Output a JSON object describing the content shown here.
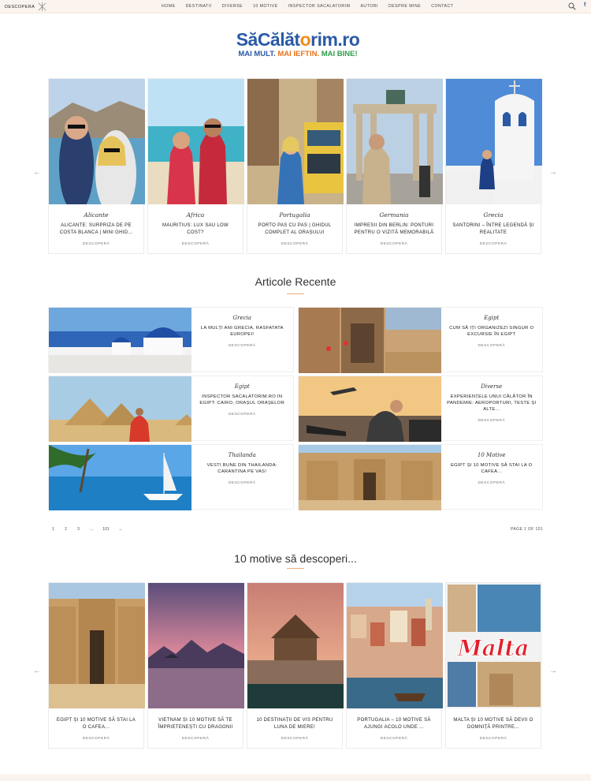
{
  "topbar": {
    "menu_label": "DESCOPERA",
    "nav": [
      "HOME",
      "DESTINATII",
      "DIVERSE",
      "10 MOTIVE",
      "INSPECTOR SACALATORIM",
      "AUTORI",
      "DESPRE MINE",
      "CONTACT"
    ],
    "social": "f"
  },
  "logo": {
    "brand_part1": "SăCălăt",
    "brand_part2": "o",
    "brand_part3": "rim.ro",
    "tag1": "MAI MULT.",
    "tag2": "MAI IEFTIN.",
    "tag3": "MAI BINE!"
  },
  "featured": [
    {
      "category": "Alicante",
      "title": "ALICANTE: SURPRIZA DE PE COSTA BLANCA | MINI GHID...",
      "more": "DESCOPERĂ"
    },
    {
      "category": "Africa",
      "title": "MAURITIUS: LUX SAU LOW COST?",
      "more": "DESCOPERĂ"
    },
    {
      "category": "Portugalia",
      "title": "PORTO PAS CU PAS | GHIDUL COMPLET AL ORAȘULUI",
      "more": "DESCOPERĂ"
    },
    {
      "category": "Germania",
      "title": "IMPRESII DIN BERLIN: PONTURI PENTRU O VIZITĂ MEMORABILĂ",
      "more": "DESCOPERĂ"
    },
    {
      "category": "Grecia",
      "title": "SANTORINI – ÎNTRE LEGENDĂ ȘI REALITATE",
      "more": "DESCOPERĂ"
    }
  ],
  "recent": {
    "heading": "Articole Recente",
    "items": [
      {
        "category": "Grecia",
        "title": "LA MULȚI ANI GRECIA, RASFATATA EUROPEI!",
        "more": "DESCOPERĂ"
      },
      {
        "category": "Egipt",
        "title": "CUM SĂ IȚI ORGANIZEZI SINGUR O EXCURSIE ÎN EGIPT",
        "more": "DESCOPERĂ"
      },
      {
        "category": "Egipt",
        "title": "INSPECTOR SACALATORIM.RO IN EGIPT: CAIRO, ORAȘUL ORAȘELOR",
        "more": "DESCOPERĂ"
      },
      {
        "category": "Diverse",
        "title": "EXPERIENȚELE UNUI CĂLĂTOR ÎN PANDEMIE: AEROPORTURI, TESTE ȘI ALTE...",
        "more": "DESCOPERĂ"
      },
      {
        "category": "Thailanda",
        "title": "VESTI BUNE DIN THAILANDA: CARANTINA PE VAS!",
        "more": "DESCOPERĂ"
      },
      {
        "category": "10 Motive",
        "title": "EGIPT ȘI 10 MOTIVE SĂ STAI LA O CAFEA...",
        "more": "DESCOPERĂ"
      }
    ]
  },
  "pagination": {
    "pages": [
      "1",
      "2",
      "3",
      "...",
      "101"
    ],
    "next": "→",
    "info": "PAGE 1 OF 101"
  },
  "motive": {
    "heading": "10 motive să descoperi...",
    "items": [
      {
        "title": "EGIPT ȘI 10 MOTIVE SĂ STAI LA O CAFEA...",
        "more": "DESCOPERĂ"
      },
      {
        "title": "VIETNAM ȘI 10 MOTIVE SĂ TE ÎMPRIETENEȘTI CU DRAGONII",
        "more": "DESCOPERĂ"
      },
      {
        "title": "10 DESTINAȚII DE VIS PENTRU LUNA DE MIERE!",
        "more": "DESCOPERĂ"
      },
      {
        "title": "PORTUGALIA – 10 MOTIVE SĂ AJUNGI ACOLO UNDE ...",
        "more": "DESCOPERĂ"
      },
      {
        "title": "MALTA ȘI 10 MOTIVE SĂ DEVII O DOMNIȚĂ PRINTRE...",
        "more": "DESCOPERĂ"
      }
    ],
    "malta_sign": "Malta"
  },
  "colors": {
    "accent": "#f2a97a",
    "brand_blue": "#2a5aa6",
    "brand_orange": "#e8731c",
    "brand_green": "#2f9e4a",
    "topbar_bg": "#fbf4ee"
  },
  "icons": [
    "menu-x-icon",
    "search-icon",
    "facebook-icon",
    "arrow-left-icon",
    "arrow-right-icon"
  ]
}
